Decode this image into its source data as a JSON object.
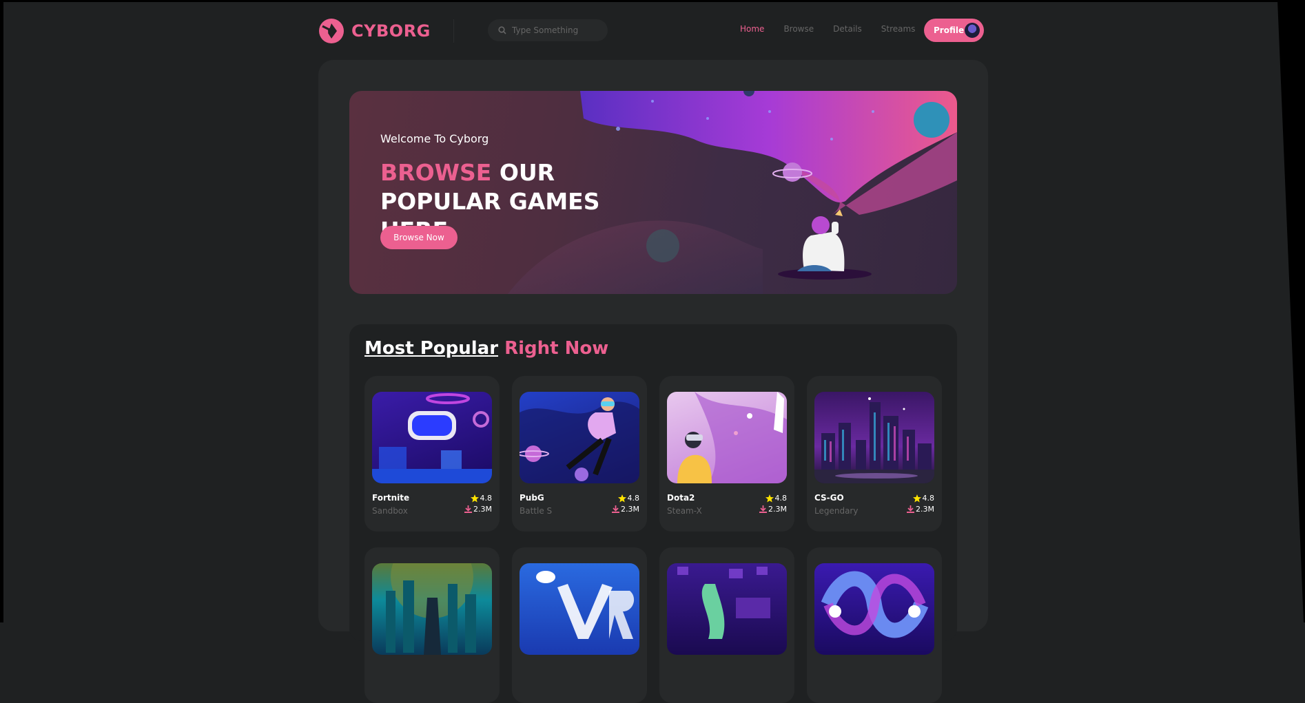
{
  "brand": {
    "name": "CYBORG"
  },
  "search": {
    "placeholder": "Type Something"
  },
  "nav": {
    "items": [
      {
        "label": "Home"
      },
      {
        "label": "Browse"
      },
      {
        "label": "Details"
      },
      {
        "label": "Streams"
      }
    ],
    "profile_label": "Profile"
  },
  "banner": {
    "welcome": "Welcome To Cyborg",
    "headline_highlight": "BROWSE",
    "headline_rest": " OUR POPULAR GAMES HERE",
    "button_label": "Browse Now"
  },
  "popular": {
    "title_first": "Most Popular",
    "title_second": "Right Now",
    "games": [
      {
        "name": "Fortnite",
        "genre": "Sandbox",
        "rating": "4.8",
        "downloads": "2.3M"
      },
      {
        "name": "PubG",
        "genre": "Battle S",
        "rating": "4.8",
        "downloads": "2.3M"
      },
      {
        "name": "Dota2",
        "genre": "Steam-X",
        "rating": "4.8",
        "downloads": "2.3M"
      },
      {
        "name": "CS-GO",
        "genre": "Legendary",
        "rating": "4.8",
        "downloads": "2.3M"
      }
    ]
  },
  "colors": {
    "accent": "#ec6090",
    "background": "#1f2122",
    "panel": "#27292a",
    "muted": "#666666"
  },
  "icons": [
    "logo-icon",
    "search-icon",
    "star-icon",
    "download-icon",
    "avatar"
  ]
}
